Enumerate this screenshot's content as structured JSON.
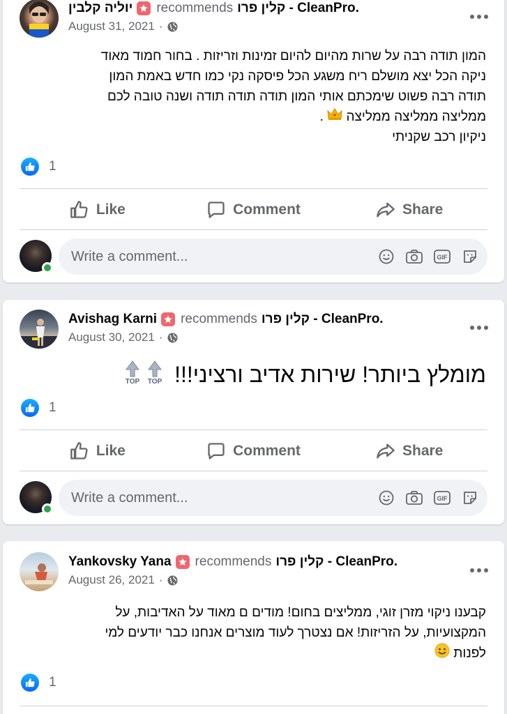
{
  "posts": [
    {
      "author": "יוליה קלבין",
      "recommends": "recommends",
      "page": "קלין פרו - CleanPro.",
      "date": "August 31, 2021",
      "dot": "·",
      "text_lines": [
        "המון תודה רבה על שרות מהיום להיום זמינות וזריזות . בחור חמוד מאוד",
        "ניקה הכל יצא מושלם ריח משגע הכל פיסקה נקי כמו חדש באמת המון",
        "תודה רבה פשוט שימכתם אותי המון תודה תודה תודה ושנה טובה לכם",
        "ממליצה ממליצה ממליצה",
        "ניקיון רכב שקניתי"
      ],
      "line4_suffix": " .",
      "reaction_count": "1",
      "emoji_icon": "crown-emoji"
    },
    {
      "author": "Avishag Karni",
      "recommends": "recommends",
      "page": "קלין פרו - CleanPro.",
      "date": "August 30, 2021",
      "dot": "·",
      "text": "מומלץ ביותר! שירות אדיב ורציני!!!",
      "top_label": "TOP",
      "reaction_count": "1",
      "emoji_icon": "top-arrow-emoji"
    },
    {
      "author": "Yankovsky Yana",
      "recommends": "recommends",
      "page": "קלין פרו - CleanPro.",
      "date": "August 26, 2021",
      "dot": "·",
      "text_lines": [
        "קבענו ניקוי מזרן זוגי, ממליצים בחום! מודים ם מאוד על האדיבות, על",
        "המקצועיות, על הזריזות! אם נצטרך לעוד מוצרים אנחנו כבר יודעים למי",
        "לפנות"
      ],
      "reaction_count": "1",
      "emoji_icon": "smile-emoji"
    }
  ],
  "actions": {
    "like": "Like",
    "comment": "Comment",
    "share": "Share"
  },
  "comment_placeholder": "Write a comment...",
  "icons": {
    "like": "thumbs-up-icon",
    "comment": "comment-bubble-icon",
    "share": "share-arrow-icon",
    "globe": "globe-icon",
    "more": "more-options-icon",
    "emoji": "emoji-icon",
    "camera": "camera-icon",
    "gif": "gif-icon",
    "sticker": "sticker-icon"
  },
  "colors": {
    "like_blue": "#0866ff",
    "recommend_badge": "#f0666f",
    "online": "#31a24c",
    "secondary_text": "#65676b"
  }
}
